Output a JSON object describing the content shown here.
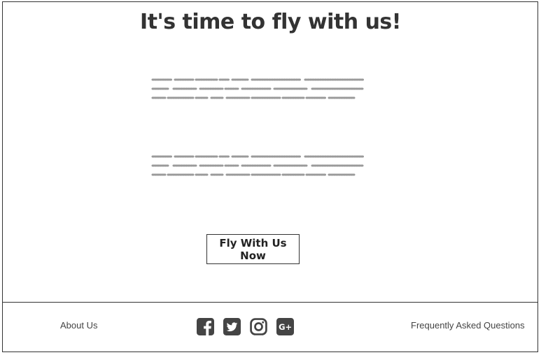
{
  "hero": {
    "title": "It's time to fly with us!"
  },
  "cta": {
    "label": "Fly With Us Now"
  },
  "footer": {
    "left_link": "About Us",
    "right_link": "Frequently Asked Questions",
    "socials": [
      {
        "icon": "facebook-icon"
      },
      {
        "icon": "twitter-icon"
      },
      {
        "icon": "instagram-icon"
      },
      {
        "icon": "google-plus-icon"
      }
    ]
  },
  "colors": {
    "text": "#333333",
    "placeholder_text": "#999999",
    "icon": "#444444"
  }
}
